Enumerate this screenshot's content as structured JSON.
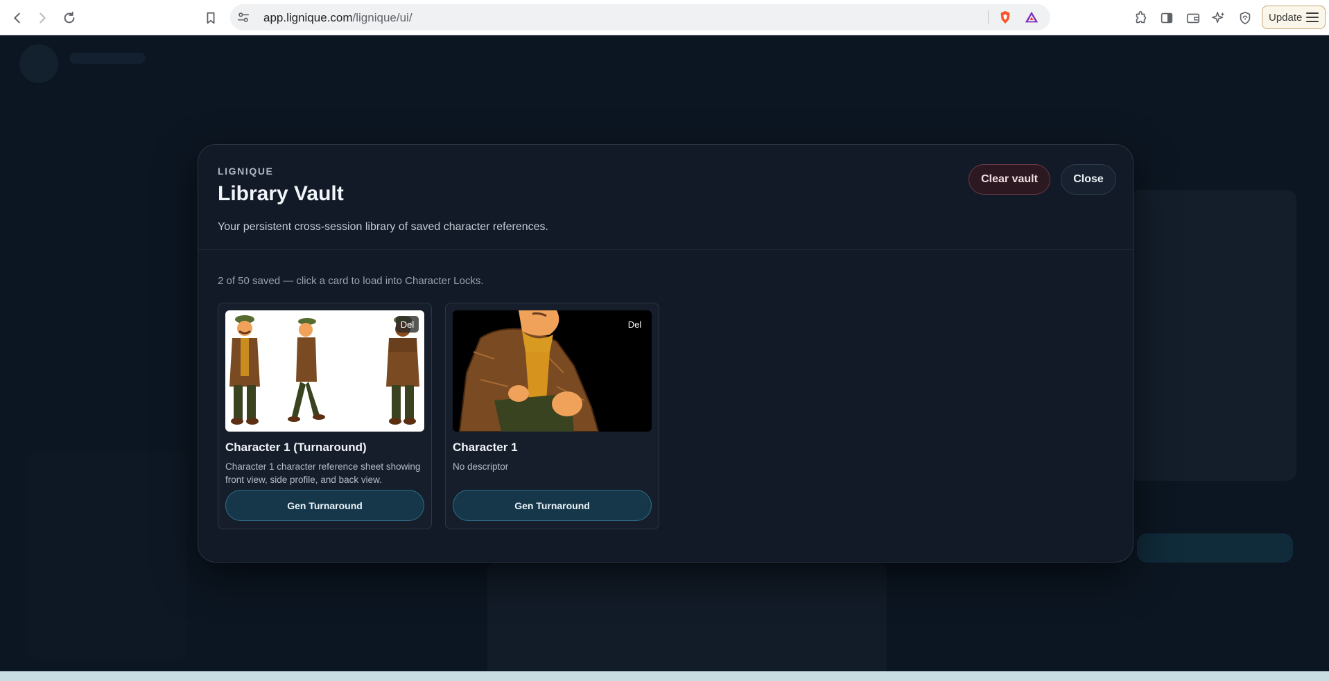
{
  "browser": {
    "url_host": "app.lignique.com",
    "url_path": "/lignique/ui/",
    "update_label": "Update"
  },
  "modal": {
    "eyebrow": "LIGNIQUE",
    "title": "Library Vault",
    "subtitle": "Your persistent cross-session library of saved character references.",
    "clear_label": "Clear vault",
    "close_label": "Close",
    "count_text": "2 of 50 saved — click a card to load into Character Locks.",
    "cards": [
      {
        "title": "Character 1 (Turnaround)",
        "description": "Character 1 character reference sheet showing front view, side profile, and back view.",
        "del_label": "Del",
        "button_label": "Gen Turnaround"
      },
      {
        "title": "Character 1",
        "description": "No descriptor",
        "del_label": "Del",
        "button_label": "Gen Turnaround"
      }
    ]
  },
  "colors": {
    "accent_button": "#16374a",
    "danger_button": "#2c1820",
    "modal_bg": "#111a26"
  }
}
